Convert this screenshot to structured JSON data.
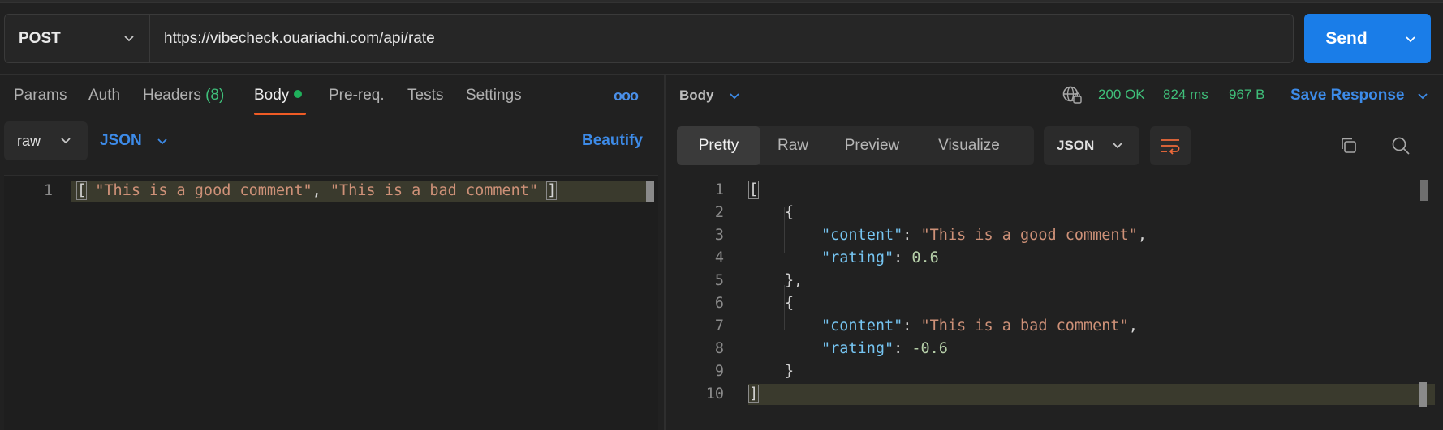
{
  "request": {
    "method": "POST",
    "url": "https://vibecheck.ouariachi.com/api/rate",
    "send_label": "Send"
  },
  "request_tabs": [
    {
      "label": "Params"
    },
    {
      "label": "Auth"
    },
    {
      "label": "Headers",
      "count": "(8)"
    },
    {
      "label": "Body",
      "active": true
    },
    {
      "label": "Pre-req."
    },
    {
      "label": "Tests"
    },
    {
      "label": "Settings"
    }
  ],
  "more_label": "ooo",
  "body_options": {
    "mode": "raw",
    "language": "JSON",
    "beautify_label": "Beautify"
  },
  "request_body": {
    "line_number": "1",
    "open_bracket": "[",
    "items": [
      "\"This is a good comment\"",
      "\"This is a bad comment\""
    ],
    "separator": ",",
    "close_bracket": "]"
  },
  "response": {
    "section_label": "Body",
    "status": "200 OK",
    "time": "824 ms",
    "size": "967 B",
    "save_label": "Save Response",
    "view_tabs": [
      "Pretty",
      "Raw",
      "Preview",
      "Visualize"
    ],
    "active_view": "Pretty",
    "format": "JSON",
    "lines": {
      "numbers": [
        "1",
        "2",
        "3",
        "4",
        "5",
        "6",
        "7",
        "8",
        "9",
        "10"
      ],
      "key_content": "\"content\"",
      "key_rating": "\"rating\"",
      "value_good": "\"This is a good comment\"",
      "value_bad": "\"This is a bad comment\"",
      "rating_good": "0.6",
      "rating_bad": "-0.6"
    }
  },
  "colors": {
    "accent": "#1a7de8",
    "status_green": "#3fbf7a",
    "active_tab_underline": "#ef5b25"
  }
}
